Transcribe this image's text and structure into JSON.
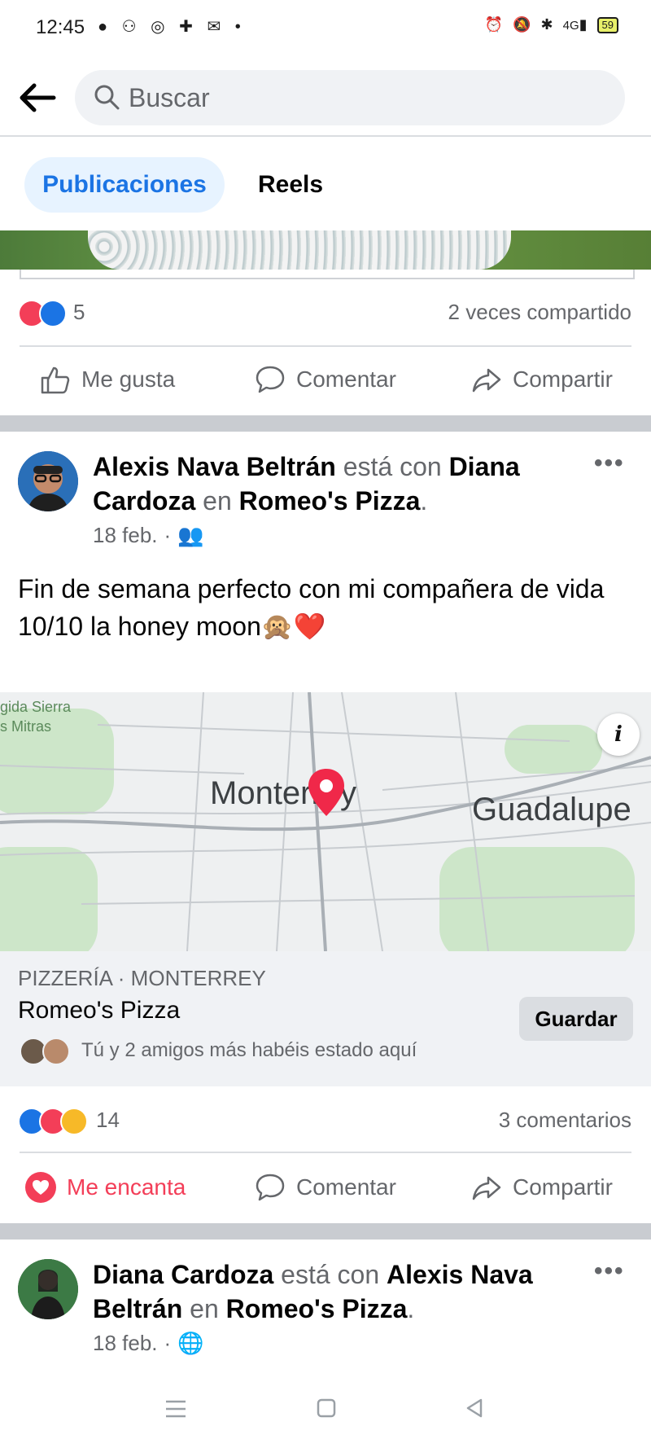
{
  "status_bar": {
    "time": "12:45",
    "battery": "59",
    "network": "4G"
  },
  "search": {
    "placeholder": "Buscar"
  },
  "tabs": [
    {
      "label": "Publicaciones",
      "active": true
    },
    {
      "label": "Reels",
      "active": false
    }
  ],
  "post1": {
    "reactions_count": "5",
    "shares": "2 veces compartido",
    "actions": {
      "like": "Me gusta",
      "comment": "Comentar",
      "share": "Compartir"
    }
  },
  "post2": {
    "author": "Alexis Nava Beltrán",
    "with_text": "está con",
    "tagged": "Diana Cardoza",
    "at_text": "en",
    "place": "Romeo's Pizza",
    "date": "18 feb.",
    "text_line1": "Fin de semana perfecto con mi compañera de vida",
    "text_line2": "10/10 la honey moon🙊❤️",
    "map": {
      "label_city": "Monterrey",
      "label_city2": "Guadalupe",
      "label_area": "gida Sierra",
      "label_area2": "s Mitras"
    },
    "place_card": {
      "category": "PIZZERÍA · MONTERREY",
      "name": "Romeo's Pizza",
      "save_label": "Guardar",
      "friends_text": "Tú y 2 amigos más habéis estado aquí"
    },
    "reactions_count": "14",
    "comments": "3 comentarios",
    "actions": {
      "love": "Me encanta",
      "comment": "Comentar",
      "share": "Compartir"
    }
  },
  "post3": {
    "author": "Diana Cardoza",
    "with_text": "está con",
    "tagged": "Alexis Nava Beltrán",
    "at_text": "en",
    "place": "Romeo's Pizza",
    "date": "18 feb."
  },
  "colors": {
    "accent": "#1b74e4",
    "love": "#f33e58",
    "muted": "#65676b",
    "tab_bg": "#e7f3ff"
  }
}
